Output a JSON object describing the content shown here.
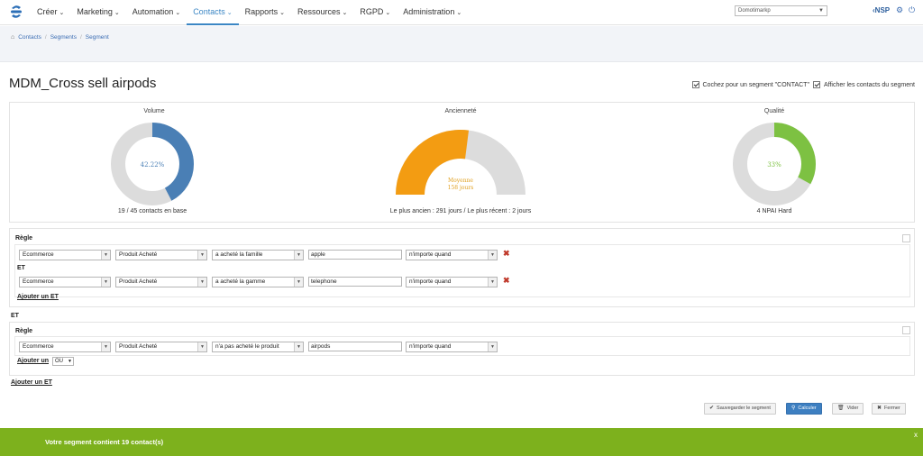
{
  "nav": {
    "menu": [
      {
        "label": "Créer"
      },
      {
        "label": "Marketing"
      },
      {
        "label": "Automation"
      },
      {
        "label": "Contacts"
      },
      {
        "label": "Rapports"
      },
      {
        "label": "Ressources"
      },
      {
        "label": "RGPD"
      },
      {
        "label": "Administration"
      }
    ],
    "active_index": 3,
    "account_select": "Domotimarkp",
    "user_badge": "‹NSP"
  },
  "breadcrumb": [
    "Contacts",
    "Segments",
    "Segment"
  ],
  "page": {
    "title": "MDM_Cross sell airpods",
    "opt_contact_label": "Cochez pour un segment \"CONTACT\"",
    "opt_show_label": "Afficher les contacts du segment"
  },
  "stats": {
    "volume": {
      "title": "Volume",
      "center": "42.22%",
      "caption": "19 / 45 contacts en base",
      "fraction": 0.4222,
      "color": "#4a7fb5"
    },
    "anciennete": {
      "title": "Ancienneté",
      "center_line1": "Moyenne",
      "center_line2": "158 jours",
      "caption": "Le plus ancien : 291 jours / Le plus récent : 2 jours",
      "fraction": 0.54,
      "color": "#f39c12"
    },
    "qualite": {
      "title": "Qualité",
      "center": "33%",
      "caption": "4 NPAI Hard",
      "fraction": 0.33,
      "color": "#7dc142"
    }
  },
  "rules": {
    "regle_label": "Règle",
    "et_label": "ET",
    "group1": [
      {
        "s1": "Ecommerce",
        "s2": "Produit Acheté",
        "s3": "a acheté la famille",
        "value": "apple",
        "s4": "n'importe quand"
      },
      {
        "s1": "Ecommerce",
        "s2": "Produit Acheté",
        "s3": "a acheté la gamme",
        "value": "telephone",
        "s4": "n'importe quand"
      }
    ],
    "add_and": "Ajouter un ET",
    "group2": [
      {
        "s1": "Ecommerce",
        "s2": "Produit Acheté",
        "s3": "n'a pas acheté le produit",
        "value": "airpods",
        "s4": "n'importe quand"
      }
    ],
    "add_label": "Ajouter un",
    "or_option": "OU",
    "add_and_outer": "Ajouter un ET"
  },
  "buttons": {
    "save": "Sauvegarder le segment",
    "calc": "Calculer",
    "clear": "Vider",
    "close": "Fermer"
  },
  "notice": {
    "text": "Votre segment contient 19 contact(s)",
    "close": "x"
  }
}
